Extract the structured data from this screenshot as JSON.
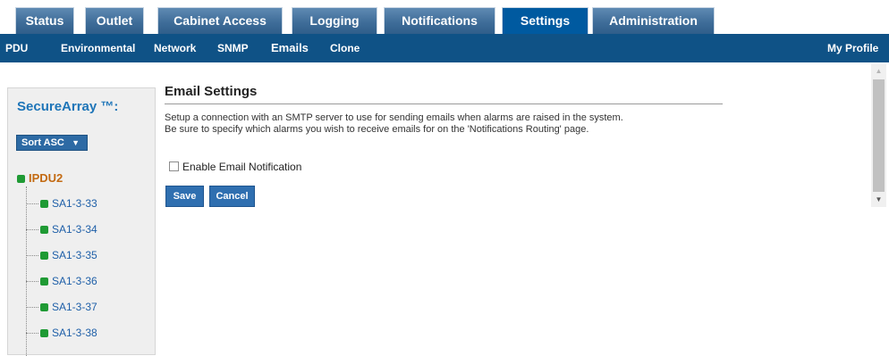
{
  "tabs": [
    {
      "label": "Status"
    },
    {
      "label": "Outlet"
    },
    {
      "label": "Cabinet Access"
    },
    {
      "label": "Logging"
    },
    {
      "label": "Notifications"
    },
    {
      "label": "Settings",
      "active": true
    },
    {
      "label": "Administration"
    }
  ],
  "subnav": {
    "items": [
      "PDU",
      "Environmental",
      "Network",
      "SNMP",
      "Emails",
      "Clone"
    ],
    "active": "Emails",
    "profile": "My Profile"
  },
  "sidebar": {
    "brand": "SecureArray ™:",
    "sort_label": "Sort ASC",
    "sort_caret": "▼",
    "root": "IPDU2",
    "children": [
      "SA1-3-33",
      "SA1-3-34",
      "SA1-3-35",
      "SA1-3-36",
      "SA1-3-37",
      "SA1-3-38"
    ],
    "status_color": "#1f9a34"
  },
  "main": {
    "title": "Email Settings",
    "description_line1": "Setup a connection with an SMTP server to use for sending emails when alarms are raised in the system.",
    "description_line2": "Be sure to specify which alarms you wish to receive emails for on the 'Notifications Routing' page.",
    "enable_label": "Enable Email Notification",
    "enable_checked": false,
    "save_label": "Save",
    "cancel_label": "Cancel"
  },
  "colors": {
    "tab": "#3f6d99",
    "tab_active": "#005aa0",
    "subnav": "#0f5286",
    "brand": "#1e75b8",
    "root": "#c36a12",
    "child_link": "#1e5fa8"
  },
  "icons": {
    "status_dot": "status-dot-icon",
    "scroll_up": "scroll-up-icon",
    "scroll_down": "scroll-down-icon"
  }
}
